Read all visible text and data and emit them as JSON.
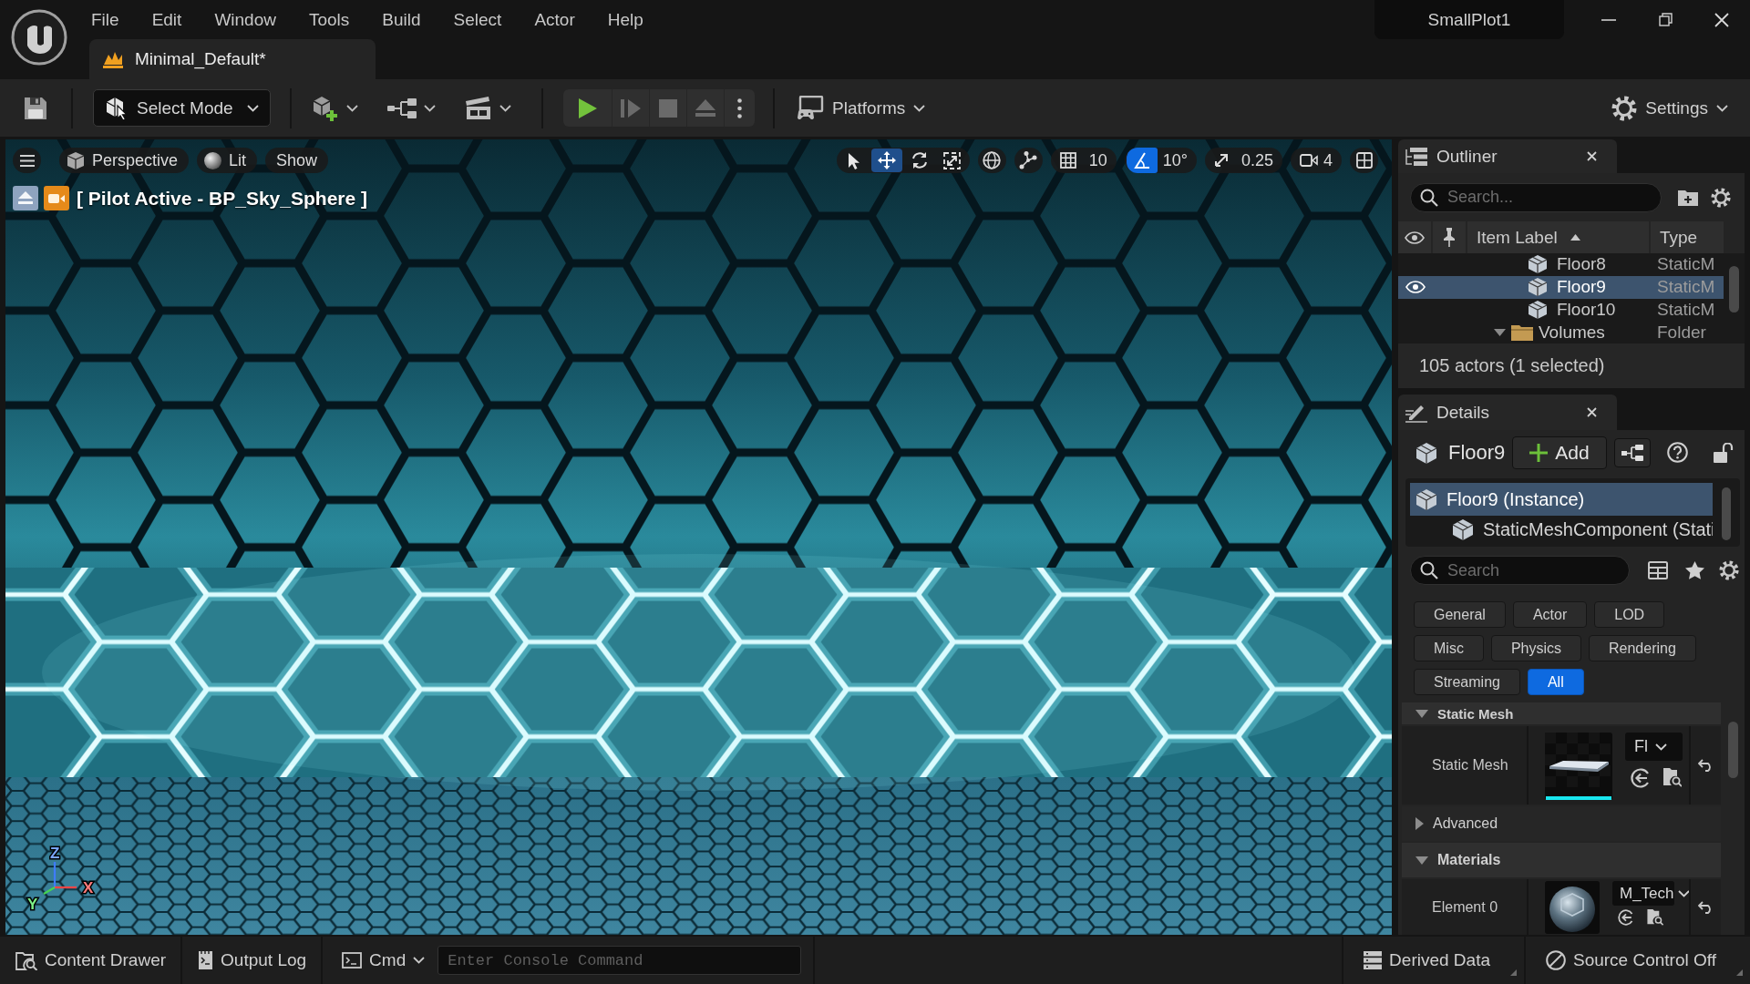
{
  "title_bar": {
    "menu": [
      "File",
      "Edit",
      "Window",
      "Tools",
      "Build",
      "Select",
      "Actor",
      "Help"
    ],
    "document_tab": "Minimal_Default*",
    "project": "SmallPlot1"
  },
  "toolbar": {
    "mode": "Select Mode",
    "play_controls": [
      {
        "kind": "play",
        "disabled": false
      },
      {
        "kind": "advance",
        "disabled": true
      },
      {
        "kind": "stop",
        "disabled": true
      },
      {
        "kind": "eject",
        "disabled": true
      }
    ],
    "platforms": "Platforms",
    "settings": "Settings"
  },
  "viewport": {
    "view_options": [
      {
        "kind": "perspective",
        "label": "Perspective"
      },
      {
        "kind": "lit",
        "label": "Lit"
      },
      {
        "kind": "show",
        "label": "Show"
      }
    ],
    "transform_tools": [
      {
        "kind": "select",
        "selected": false
      },
      {
        "kind": "translate",
        "selected": true
      },
      {
        "kind": "rotate",
        "selected": false
      },
      {
        "kind": "scale",
        "selected": false
      }
    ],
    "snaps": [
      {
        "kind": "grid",
        "value": "10",
        "on": false
      },
      {
        "kind": "rotation",
        "value": "10°",
        "on": true
      },
      {
        "kind": "scale",
        "value": "0.25",
        "on": false
      }
    ],
    "camera_speed": "4",
    "pilot_label": "[ Pilot Active - BP_Sky_Sphere ]",
    "axes": [
      "Z",
      "Y",
      "X"
    ]
  },
  "outliner": {
    "title": "Outliner",
    "search_placeholder": "Search...",
    "columns": [
      {
        "label": "Item Label",
        "sorted": true
      },
      {
        "label": "Type",
        "sorted": false
      }
    ],
    "rows": [
      {
        "kind": "mesh",
        "label": "Floor8",
        "type": "StaticM",
        "selected": false
      },
      {
        "kind": "mesh",
        "label": "Floor9",
        "type": "StaticM",
        "selected": true
      },
      {
        "kind": "mesh",
        "label": "Floor10",
        "type": "StaticM",
        "selected": false
      },
      {
        "kind": "folder",
        "label": "Volumes",
        "type": "Folder",
        "selected": false,
        "expanded": true
      }
    ],
    "footer": "105 actors (1 selected)"
  },
  "details": {
    "title": "Details",
    "actor": "Floor9",
    "add_button": "Add",
    "locked": false,
    "components": [
      {
        "label": "Floor9 (Instance)",
        "selected": true,
        "children": [
          {
            "label": "StaticMeshComponent (Stati",
            "selected": false
          }
        ]
      }
    ],
    "search_placeholder": "Search",
    "filters": [
      {
        "label": "General",
        "selected": false
      },
      {
        "label": "Actor",
        "selected": false
      },
      {
        "label": "LOD",
        "selected": false
      },
      {
        "label": "Misc",
        "selected": false
      },
      {
        "label": "Physics",
        "selected": false
      },
      {
        "label": "Rendering",
        "selected": false
      },
      {
        "label": "Streaming",
        "selected": false
      },
      {
        "label": "All",
        "selected": true
      }
    ],
    "sections": [
      {
        "kind": "category",
        "title": "Static Mesh",
        "expanded": true,
        "properties": [
          {
            "kind": "mesh",
            "label": "Static Mesh",
            "asset": "Fl"
          }
        ]
      },
      {
        "kind": "subgroup",
        "title": "Advanced",
        "expanded": false
      },
      {
        "kind": "category",
        "title": "Materials",
        "expanded": true,
        "properties": [
          {
            "kind": "material",
            "label": "Element 0",
            "asset": "M_Tech"
          }
        ]
      }
    ]
  },
  "status_bar": {
    "buttons": [
      {
        "kind": "content_drawer",
        "label": "Content Drawer"
      },
      {
        "kind": "output_log",
        "label": "Output Log"
      }
    ],
    "cmd": "Cmd",
    "console_placeholder": "Enter Console Command",
    "indicators": [
      {
        "kind": "derived_data",
        "label": "Derived Data"
      },
      {
        "kind": "source_control",
        "label": "Source Control Off"
      }
    ]
  }
}
